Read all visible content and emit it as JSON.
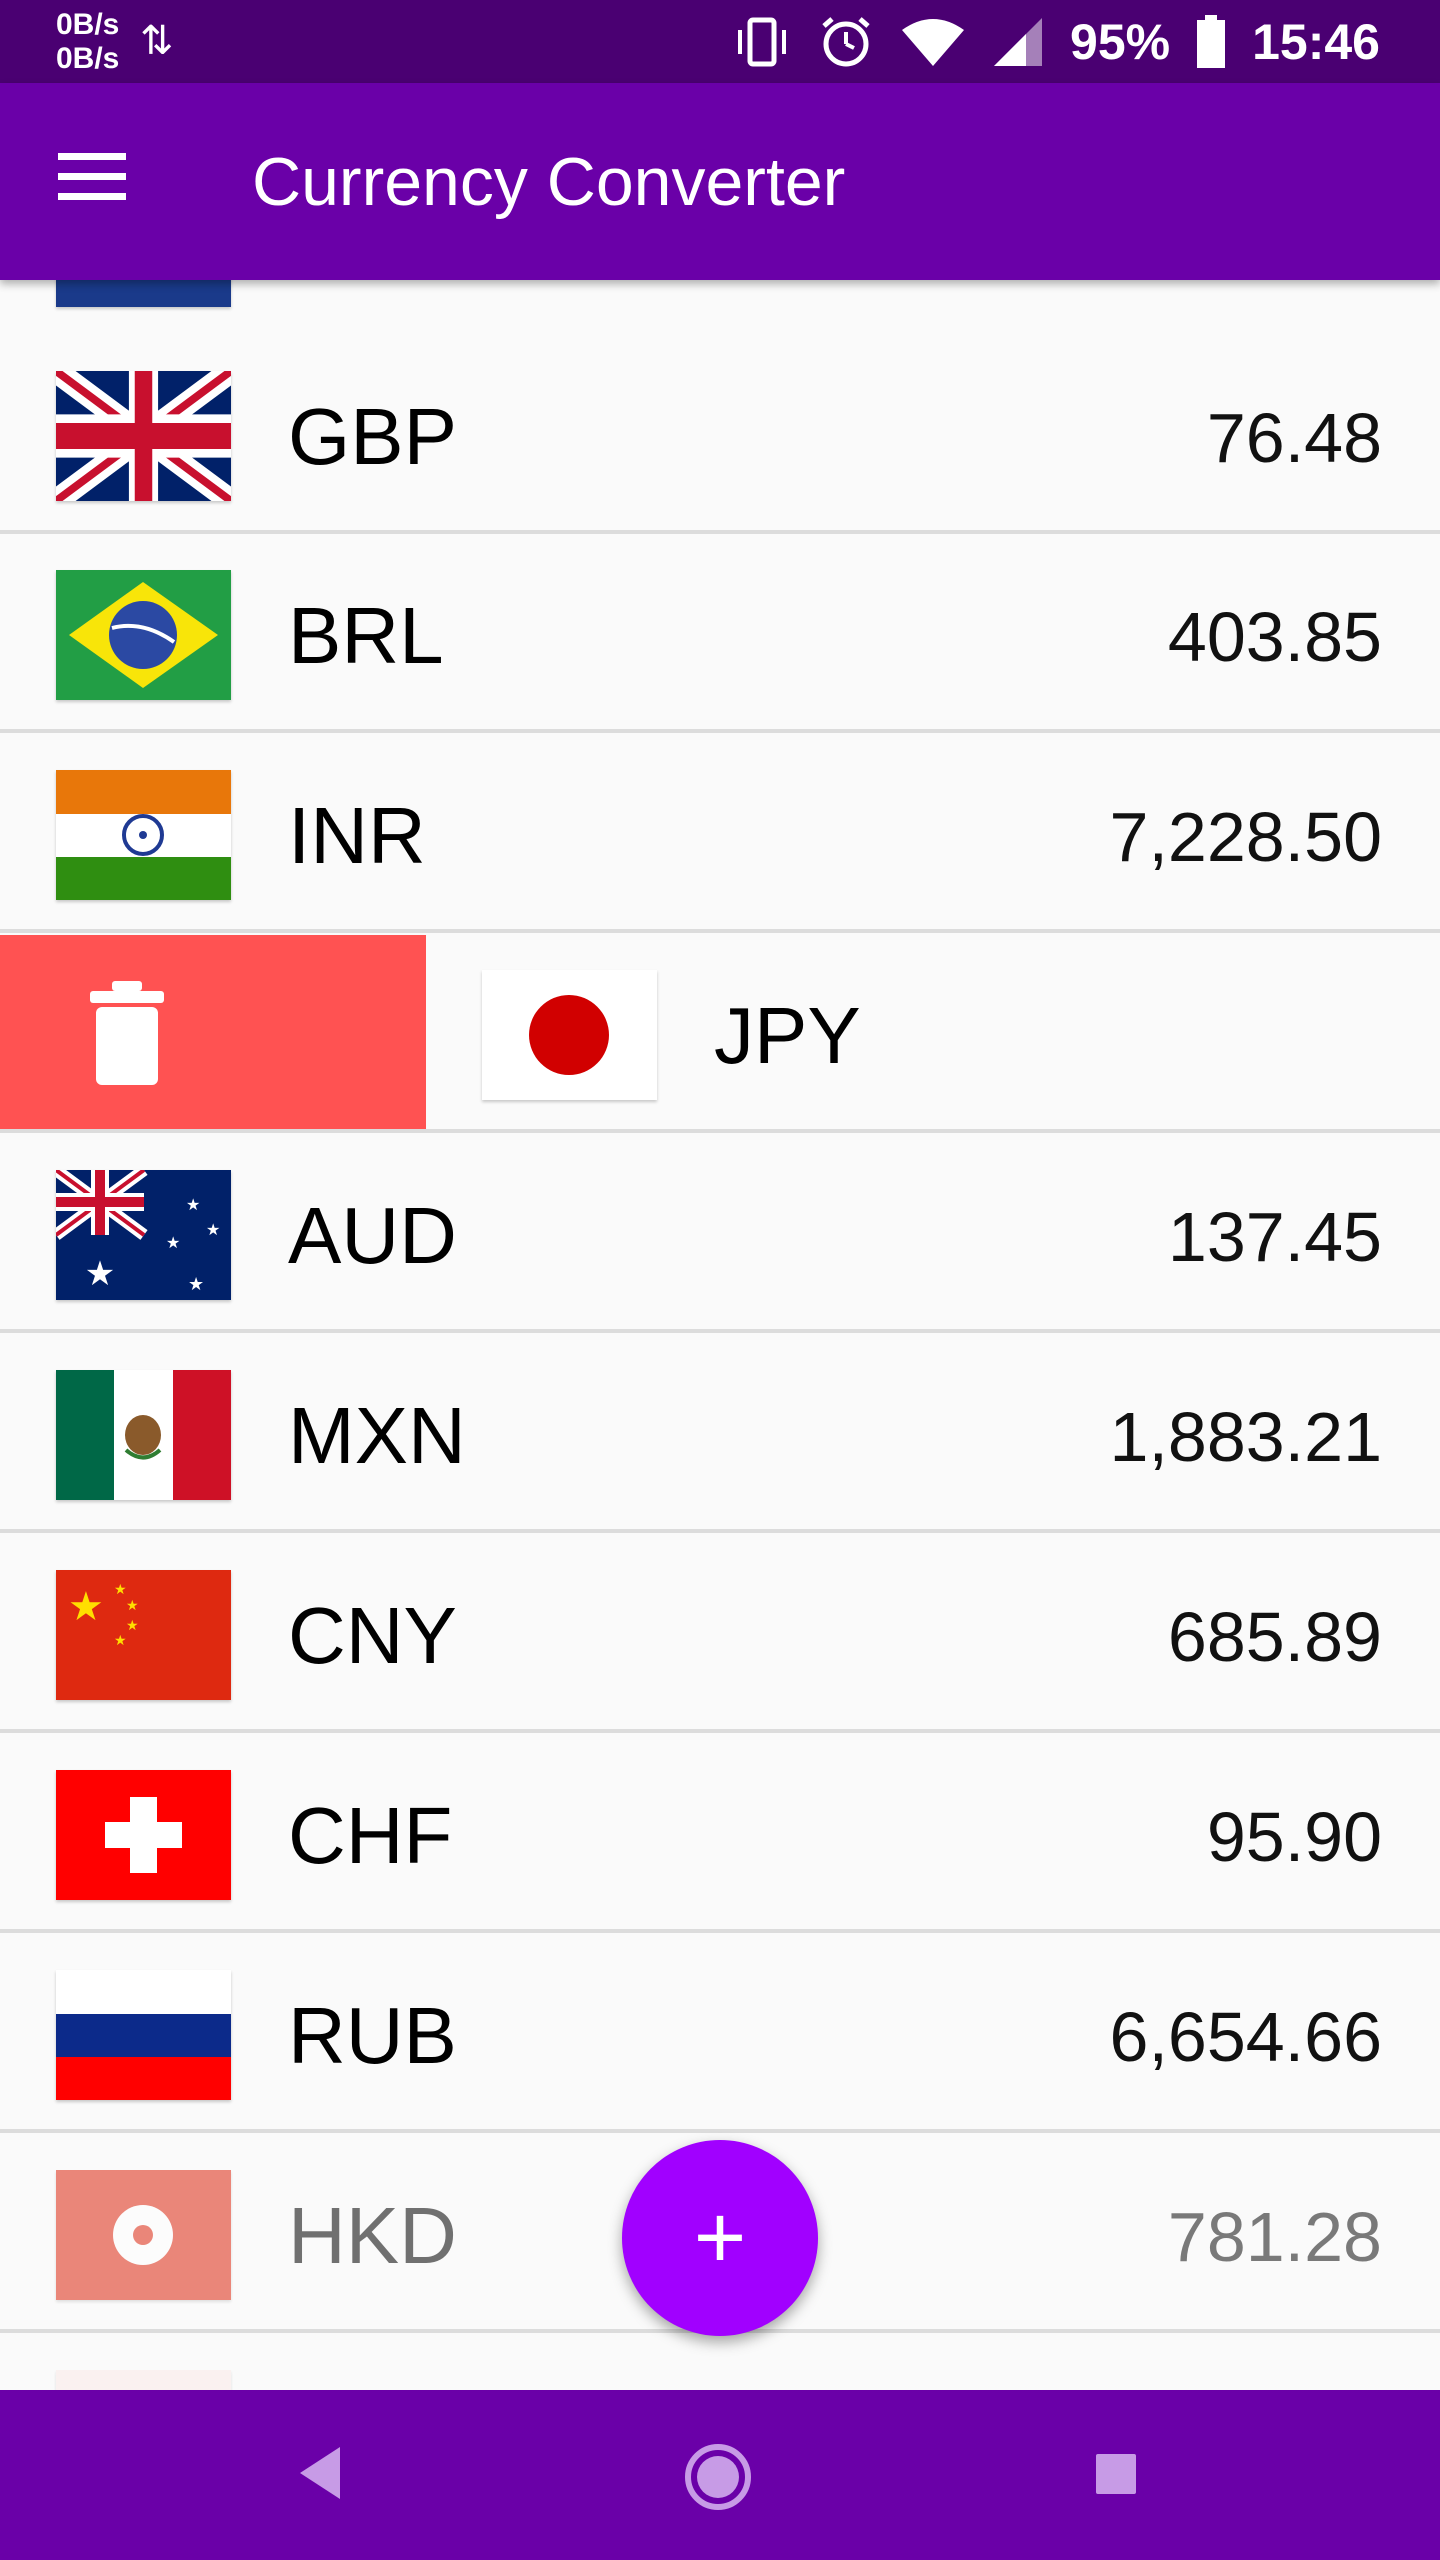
{
  "status": {
    "net_up": "0B/s",
    "net_down": "0B/s",
    "battery": "95%",
    "time": "15:46"
  },
  "appbar": {
    "title": "Currency Converter"
  },
  "currencies": [
    {
      "code": "GBP",
      "value": "76.48"
    },
    {
      "code": "BRL",
      "value": "403.85"
    },
    {
      "code": "INR",
      "value": "7,228.50"
    },
    {
      "code": "JPY",
      "value": ""
    },
    {
      "code": "AUD",
      "value": "137.45"
    },
    {
      "code": "MXN",
      "value": "1,883.21"
    },
    {
      "code": "CNY",
      "value": "685.89"
    },
    {
      "code": "CHF",
      "value": "95.90"
    },
    {
      "code": "RUB",
      "value": "6,654.66"
    },
    {
      "code": "HKD",
      "value": "781.28"
    }
  ],
  "fab": {
    "label": "+"
  },
  "colors": {
    "statusbar": "#4a0072",
    "appbar": "#6a00a8",
    "fab": "#a100ff",
    "delete": "#ff5252"
  }
}
